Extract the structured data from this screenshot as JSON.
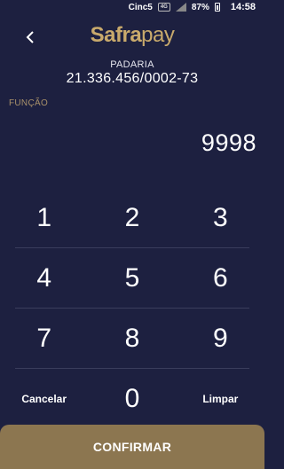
{
  "status_bar": {
    "carrier": "Cinc5",
    "network": "4G",
    "battery": "87%",
    "time": "14:58",
    "icons": [
      "signal-icon",
      "battery-icon"
    ]
  },
  "header": {
    "back_icon": "chevron-left-icon",
    "logo_bold": "Safra",
    "logo_light": "pay"
  },
  "merchant": {
    "name": "PADARIA",
    "cnpj": "21.336.456/0002-73"
  },
  "function_label": "FUNÇÃO",
  "value": "9998",
  "keypad": {
    "row1": [
      "1",
      "2",
      "3"
    ],
    "row2": [
      "4",
      "5",
      "6"
    ],
    "row3": [
      "7",
      "8",
      "9"
    ],
    "cancel": "Cancelar",
    "zero": "0",
    "clear": "Limpar"
  },
  "confirm_label": "CONFIRMAR",
  "colors": {
    "background": "#1d2040",
    "gold": "#c9aa6c",
    "confirm": "#8c7650"
  }
}
